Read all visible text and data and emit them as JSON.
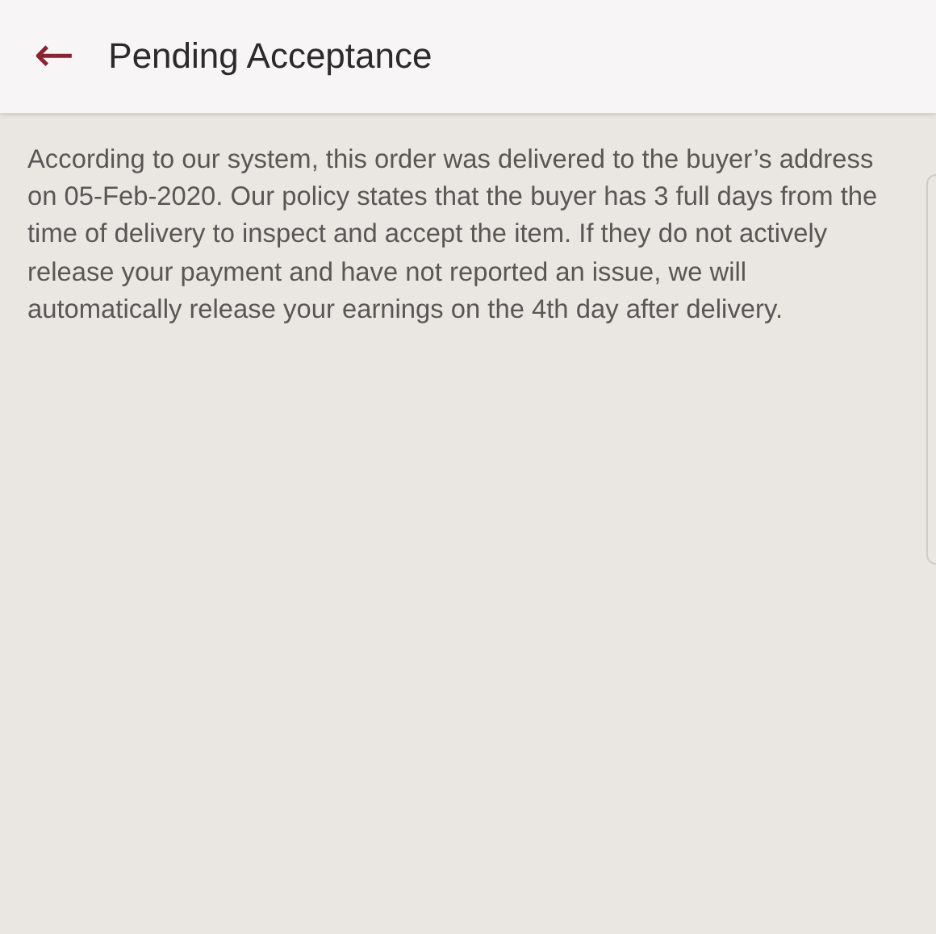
{
  "header": {
    "back_icon": "←",
    "title": "Pending Acceptance"
  },
  "body": {
    "paragraph": "According to our system, this order was delivered to the buyer’s address on 05-Feb-2020. Our policy states that the buyer has 3 full days from the time of delivery to inspect and accept the item. If they do not actively release your payment and have not reported an issue, we will automatically release your earnings on the 4th day after delivery."
  }
}
